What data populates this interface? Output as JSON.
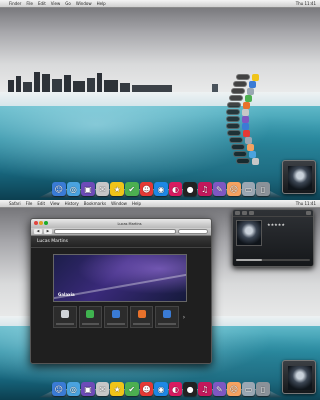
{
  "menubar_top": {
    "apple": "",
    "items": [
      "Finder",
      "File",
      "Edit",
      "View",
      "Go",
      "Window",
      "Help"
    ],
    "clock": "Thu 11:41 "
  },
  "menubar_bottom": {
    "apple": "",
    "items": [
      "Safari",
      "File",
      "Edit",
      "View",
      "History",
      "Bookmarks",
      "Window",
      "Help"
    ],
    "clock": "Thu 11:41 "
  },
  "stack_labels": [
    "",
    "",
    "",
    "",
    "",
    "",
    "",
    "",
    "",
    "",
    "",
    "",
    ""
  ],
  "dock_icons": [
    {
      "name": "finder-icon",
      "glyph": "☺",
      "color": "#3a7bd5"
    },
    {
      "name": "safari-icon",
      "glyph": "◎",
      "color": "#4aa3df"
    },
    {
      "name": "image-app-icon",
      "glyph": "▣",
      "color": "#6d4bb8"
    },
    {
      "name": "mail-icon",
      "glyph": "✉",
      "color": "#c7c7c7"
    },
    {
      "name": "star-app-icon",
      "glyph": "★",
      "color": "#f0c419"
    },
    {
      "name": "leaf-app-icon",
      "glyph": "✔",
      "color": "#4caf50"
    },
    {
      "name": "game-icon",
      "glyph": "☻",
      "color": "#e53935"
    },
    {
      "name": "target-app-icon",
      "glyph": "◉",
      "color": "#1e88e5"
    },
    {
      "name": "media-app-icon",
      "glyph": "◐",
      "color": "#d81b60"
    },
    {
      "name": "circle-app-icon",
      "glyph": "●",
      "color": "#222222"
    },
    {
      "name": "itunes-icon",
      "glyph": "♫",
      "color": "#c2185b"
    },
    {
      "name": "pencil-app-icon",
      "glyph": "✎",
      "color": "#7e57c2"
    },
    {
      "name": "character-icon",
      "glyph": "☹",
      "color": "#f4a261"
    },
    {
      "name": "folder-icon",
      "glyph": "▭",
      "color": "#9aa7b3"
    },
    {
      "name": "trash-icon",
      "glyph": "▯",
      "color": "#8b9299"
    }
  ],
  "browser": {
    "title": "Lucas Martins",
    "url": "",
    "back": "◀",
    "forward": "▶",
    "site_title": "Lucas Martins",
    "nav": [
      "",
      "",
      "",
      ""
    ],
    "hero_label": "Galaxia",
    "footer": "",
    "strip_colors": [
      "#d0d4d8",
      "#3fb34f",
      "#3a7bd5",
      "#e8712b",
      "#3a7bd5"
    ]
  },
  "media": {
    "title": "",
    "line1": "",
    "line2": "",
    "stars": "★★★★★",
    "progress": 0.35
  }
}
